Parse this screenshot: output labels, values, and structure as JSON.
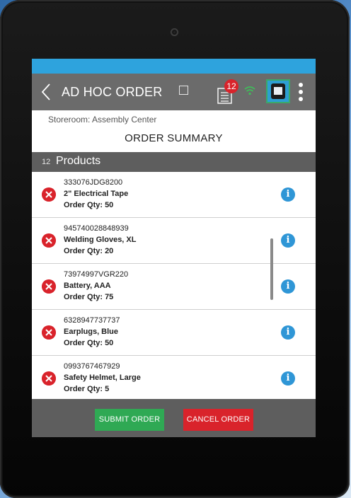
{
  "app": {
    "title": "AD HOC ORDER",
    "badge_count": "12"
  },
  "storeroom": "Storeroom: Assembly Center",
  "summary_title": "ORDER SUMMARY",
  "products": {
    "count": "12",
    "label": "Products"
  },
  "items": [
    {
      "code": "333076JDG8200",
      "name": "2\" Electrical Tape",
      "qty": "Order Qty: 50"
    },
    {
      "code": "945740028848939",
      "name": "Welding Gloves, XL",
      "qty": "Order Qty: 20"
    },
    {
      "code": "73974997VGR220",
      "name": "Battery, AAA",
      "qty": "Order Qty: 75"
    },
    {
      "code": "6328947737737",
      "name": "Earplugs, Blue",
      "qty": "Order Qty: 50"
    },
    {
      "code": "0993767467929",
      "name": "Safety Helmet, Large",
      "qty": "Order Qty: 5"
    }
  ],
  "info_glyph": "i",
  "buttons": {
    "submit": "SUBMIT ORDER",
    "cancel": "CANCEL ORDER"
  },
  "colors": {
    "status_bar": "#2ea3dd",
    "app_bar": "#6b6b6b",
    "submit": "#2fa954",
    "cancel": "#d9232b",
    "info": "#2f96d6"
  },
  "icons": [
    "back-icon",
    "checkbox-icon",
    "order-list-icon",
    "wifi-icon",
    "scanner-icon",
    "more-icon",
    "remove-icon",
    "info-icon"
  ]
}
